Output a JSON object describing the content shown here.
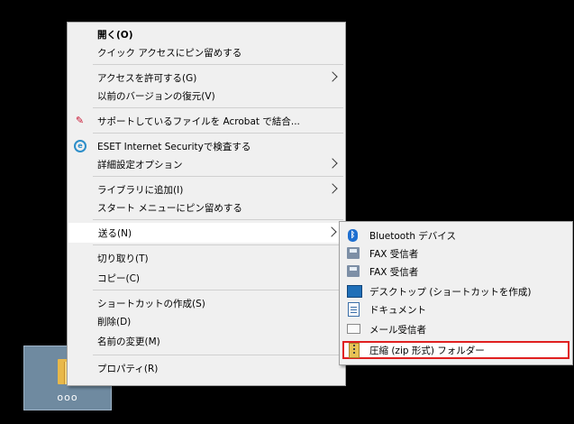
{
  "desktop": {
    "icon_label": "ooo"
  },
  "context_menu": {
    "items": [
      {
        "label": "開く(O)",
        "bold": true
      },
      {
        "label": "クイック アクセスにピン留めする"
      },
      {
        "label": "アクセスを許可する(G)",
        "submenu": true
      },
      {
        "label": "以前のバージョンの復元(V)"
      },
      {
        "label": "サポートしているファイルを Acrobat で結合...",
        "icon": "acrobat-icon"
      },
      {
        "label": "ESET Internet Securityで検査する",
        "icon": "eset-icon"
      },
      {
        "label": "詳細設定オプション",
        "submenu": true
      },
      {
        "label": "ライブラリに追加(I)",
        "submenu": true
      },
      {
        "label": "スタート メニューにピン留めする"
      },
      {
        "label": "送る(N)",
        "submenu": true,
        "selected": true
      },
      {
        "label": "切り取り(T)"
      },
      {
        "label": "コピー(C)"
      },
      {
        "label": "ショートカットの作成(S)"
      },
      {
        "label": "削除(D)"
      },
      {
        "label": "名前の変更(M)"
      },
      {
        "label": "プロパティ(R)"
      }
    ]
  },
  "send_to_menu": {
    "items": [
      {
        "label": "Bluetooth デバイス",
        "icon": "bluetooth-icon"
      },
      {
        "label": "FAX 受信者",
        "icon": "fax-icon"
      },
      {
        "label": "FAX 受信者",
        "icon": "fax-icon"
      },
      {
        "label": "デスクトップ (ショートカットを作成)",
        "icon": "desktop-icon"
      },
      {
        "label": "ドキュメント",
        "icon": "document-icon"
      },
      {
        "label": "メール受信者",
        "icon": "mail-icon"
      },
      {
        "label": "圧縮 (zip 形式) フォルダー",
        "icon": "zip-folder-icon",
        "highlighted": true
      }
    ]
  },
  "colors": {
    "highlight_border": "#e02020",
    "menu_background": "#f0f0f0"
  }
}
